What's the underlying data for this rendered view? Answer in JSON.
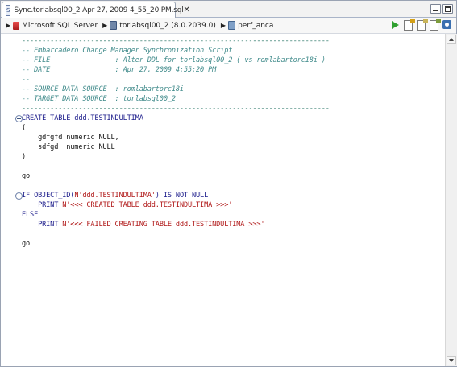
{
  "tab": {
    "title": "Sync.torlabsql00_2 Apr 27, 2009 4_55_20 PM.sql",
    "close": "✕"
  },
  "breadcrumb": {
    "server": "Microsoft SQL Server",
    "datasource": "torlabsql00_2 (8.0.2039.0)",
    "schema": "perf_anca"
  },
  "editor": {
    "lines": [
      {
        "text": "----------------------------------------------------------------------------",
        "style": "dash"
      },
      {
        "text": "-- Embarcadero Change Manager Synchronization Script",
        "style": "comment"
      },
      {
        "text": "-- FILE                : Alter DDL for torlabsql00_2 ( vs romlabartorc18i )",
        "style": "comment"
      },
      {
        "text": "-- DATE                : Apr 27, 2009 4:55:20 PM",
        "style": "comment"
      },
      {
        "text": "--",
        "style": "comment"
      },
      {
        "text": "-- SOURCE DATA SOURCE  : romlabartorc18i",
        "style": "comment"
      },
      {
        "text": "-- TARGET DATA SOURCE  : torlabsql00_2",
        "style": "comment"
      },
      {
        "text": "----------------------------------------------------------------------------",
        "style": "dash"
      },
      {
        "text": "CREATE TABLE ddd.TESTINDULTIMA",
        "style": "kw",
        "fold": true
      },
      {
        "text": "(",
        "style": "plain"
      },
      {
        "text": "    gdfgfd numeric NULL,",
        "style": "plain"
      },
      {
        "text": "    sdfgd  numeric NULL",
        "style": "plain"
      },
      {
        "text": ")",
        "style": "plain"
      },
      {
        "text": "",
        "style": "plain"
      },
      {
        "text": "go",
        "style": "plain"
      },
      {
        "text": "",
        "style": "plain"
      },
      {
        "text": "IF OBJECT_ID(N'ddd.TESTINDULTIMA') IS NOT NULL",
        "style": "kw",
        "fold": true
      },
      {
        "text": "    PRINT N'<<< CREATED TABLE ddd.TESTINDULTIMA >>>'",
        "style": "print"
      },
      {
        "text": "ELSE",
        "style": "kw"
      },
      {
        "text": "    PRINT N'<<< FAILED CREATING TABLE ddd.TESTINDULTIMA >>>'",
        "style": "print"
      },
      {
        "text": "",
        "style": "plain"
      },
      {
        "text": "go",
        "style": "plain"
      }
    ]
  },
  "colors": {
    "comment": "#3f8a8a",
    "keyword": "#1a1a8a",
    "string": "#b01818"
  },
  "icons": {
    "tab": "sql-file-icon",
    "toolbar": [
      "run-icon",
      "document-icon",
      "document-edit-icon",
      "document-check-icon",
      "settings-icon"
    ]
  }
}
